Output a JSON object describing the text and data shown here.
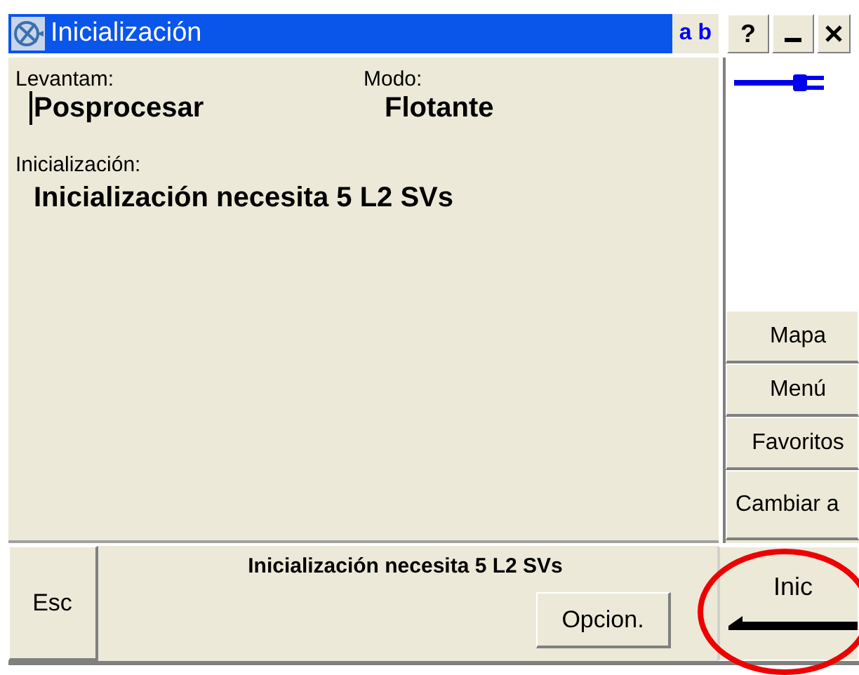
{
  "window": {
    "title": "Inicialización",
    "input_mode": "a b",
    "help": "?"
  },
  "fields": [
    {
      "label": "Levantam:",
      "value": "Posprocesar",
      "focused": true
    },
    {
      "label": "Modo:",
      "value": "Flotante",
      "focused": false
    }
  ],
  "status": {
    "label": "Inicialización:",
    "value": "Inicialización necesita 5 L2 SVs"
  },
  "side_buttons": [
    "Mapa",
    "Menú",
    "Favoritos",
    "Cambiar a"
  ],
  "footer": {
    "esc": "Esc",
    "message": "Inicialización necesita 5 L2 SVs",
    "options": "Opcion.",
    "action": "Inic"
  }
}
